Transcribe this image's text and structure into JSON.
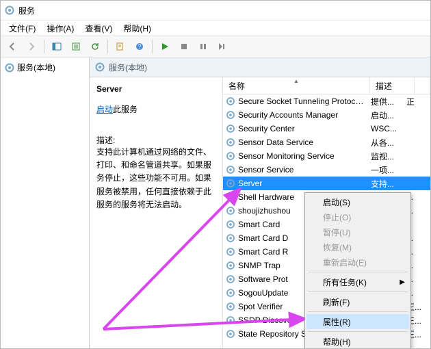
{
  "window": {
    "title": "服务"
  },
  "menu": {
    "file": "文件(F)",
    "action": "操作(A)",
    "view": "查看(V)",
    "help": "帮助(H)"
  },
  "nav": {
    "root": "服务(本地)"
  },
  "header": {
    "title": "服务(本地)"
  },
  "detail": {
    "name": "Server",
    "start_prefix": "启动",
    "start_suffix": "此服务",
    "desc_label": "描述:",
    "desc_body": "支持此计算机通过网络的文件、打印、和命名管道共享。如果服务停止，这些功能不可用。如果服务被禁用，任何直接依赖于此服务的服务将无法启动。"
  },
  "columns": {
    "name": "名称",
    "desc": "描述"
  },
  "rows": [
    {
      "name": "Secure Socket Tunneling Protocol...",
      "desc": "提供...",
      "rest": "正"
    },
    {
      "name": "Security Accounts Manager",
      "desc": "启动...",
      "rest": ""
    },
    {
      "name": "Security Center",
      "desc": "WSC...",
      "rest": ""
    },
    {
      "name": "Sensor Data Service",
      "desc": "从各...",
      "rest": ""
    },
    {
      "name": "Sensor Monitoring Service",
      "desc": "监视...",
      "rest": ""
    },
    {
      "name": "Sensor Service",
      "desc": "一项...",
      "rest": ""
    },
    {
      "name": "Server",
      "desc": "支持...",
      "rest": "",
      "selected": true
    },
    {
      "name": "Shell Hardware",
      "desc": "",
      "rest": "..."
    },
    {
      "name": "shoujizhushou",
      "desc": "",
      "rest": "..."
    },
    {
      "name": "Smart Card",
      "desc": "",
      "rest": ""
    },
    {
      "name": "Smart Card D",
      "desc": "",
      "rest": "..."
    },
    {
      "name": "Smart Card R",
      "desc": "",
      "rest": "..."
    },
    {
      "name": "SNMP Trap",
      "desc": "",
      "rest": "..."
    },
    {
      "name": "Software Prot",
      "desc": "",
      "rest": "..."
    },
    {
      "name": "SogouUpdate",
      "desc": "",
      "rest": "..."
    },
    {
      "name": "Spot Verifier",
      "desc": "",
      "rest": "正..."
    },
    {
      "name": "SSDP Discove",
      "desc": "",
      "rest": "正..."
    },
    {
      "name": "State Repository Service",
      "desc": "",
      "rest": "正..."
    }
  ],
  "context": {
    "start": "启动(S)",
    "stop": "停止(O)",
    "pause": "暂停(U)",
    "resume": "恢复(M)",
    "restart": "重新启动(E)",
    "alltasks": "所有任务(K)",
    "refresh": "刷新(F)",
    "props": "属性(R)",
    "help": "帮助(H)"
  },
  "colors": {
    "selection": "#1e90ff",
    "link": "#0066cc",
    "arrow": "#d946ef"
  }
}
